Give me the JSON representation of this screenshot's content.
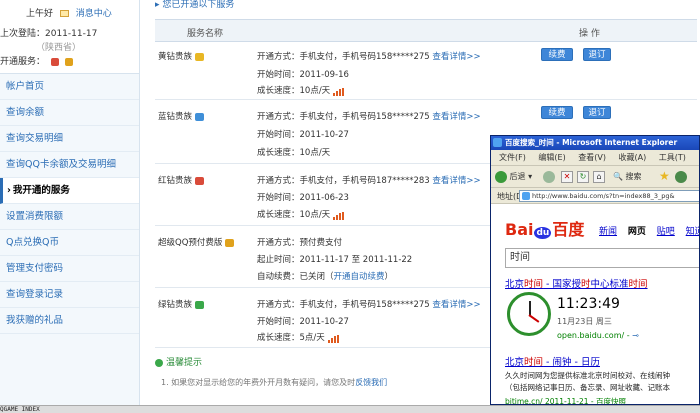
{
  "sidebar": {
    "greeting": "上午好",
    "message_center": "消息中心",
    "last_login": "上次登陆：2011-11-17",
    "login_place": "（陕西省）",
    "tq_label": "开通服务：",
    "nav": [
      "帐户首页",
      "查询余额",
      "查询交易明细",
      "查询QQ卡余额及交易明细",
      "我开通的服务",
      "设置消费限额",
      "Q点兑换Q币",
      "管理支付密码",
      "查询登录记录",
      "我获赠的礼品"
    ]
  },
  "main": {
    "heading": "您已开通以下服务",
    "col_service": "服务名称",
    "col_action": "操 作",
    "renew_label": "续费",
    "cancel_label": "退订",
    "services": [
      {
        "name": "黄钻贵族",
        "method": "开通方式：手机支付，手机号码158*****275",
        "detail": "查看详情>>",
        "start": "开始时间：2011-09-16",
        "growth": "成长速度：10点/天"
      },
      {
        "name": "蓝钻贵族",
        "method": "开通方式：手机支付，手机号码158*****275",
        "detail": "查看详情>>",
        "start": "开始时间：2011-10-27",
        "growth": "成长速度：10点/天"
      },
      {
        "name": "红钻贵族",
        "method": "开通方式：手机支付，手机号码187*****283",
        "detail": "查看详情>>",
        "start": "开始时间：2011-06-23",
        "growth": "成长速度：10点/天"
      },
      {
        "name": "超级QQ预付费版",
        "method": "开通方式：预付费支付",
        "period": "起止时间：2011-11-17 至 2011-11-22",
        "auto": "自动续费：已关闭（",
        "auto_link": "开通自动续费",
        "auto_end": "）"
      },
      {
        "name": "绿钻贵族",
        "method": "开通方式：手机支付，手机号码158*****275",
        "detail": "查看详情>>",
        "start": "开始时间：2011-10-27",
        "growth": "成长速度：5点/天"
      }
    ],
    "tips_title": "温馨提示",
    "tips_text": "1.  如果您对显示给您的年费外开月数有疑问，请您及时",
    "tips_link": "反馈我们"
  },
  "statusbar": "QGAME INDEX",
  "ie": {
    "title": "百度搜索_时间 - Microsoft Internet Explorer",
    "menu": [
      "文件(F)",
      "编辑(E)",
      "查看(V)",
      "收藏(A)",
      "工具(T)"
    ],
    "back_label": "后退",
    "search_label": "搜索",
    "address_label": "地址(D)",
    "address": "http://www.baidu.com/s?tn=index88_3_pg&",
    "baidu_nav": [
      "新闻",
      "网页",
      "贴吧",
      "知道"
    ],
    "query": "时间",
    "result1_title_a": "北京",
    "result1_title_b": "时间",
    "result1_title_c": " - 国家授",
    "result1_title_d": "时",
    "result1_title_e": "中心标准",
    "result1_title_f": "时间",
    "clock_time": "11:23:49",
    "clock_date": "11月23日  周三",
    "clock_url": "open.baidu.com/ - ",
    "result2_title_a": "北京",
    "result2_title_b": "时间",
    "result2_title_c": " - 闹钟 - 日历",
    "result2_line1": "久久时间网为您提供标准北京时间校对、在线闹钟",
    "result2_line2": "（包括网络记事日历、备忘录、网址收藏、记账本",
    "result2_url": "bjtime.cn/ 2011-11-21 - 百度快照"
  }
}
